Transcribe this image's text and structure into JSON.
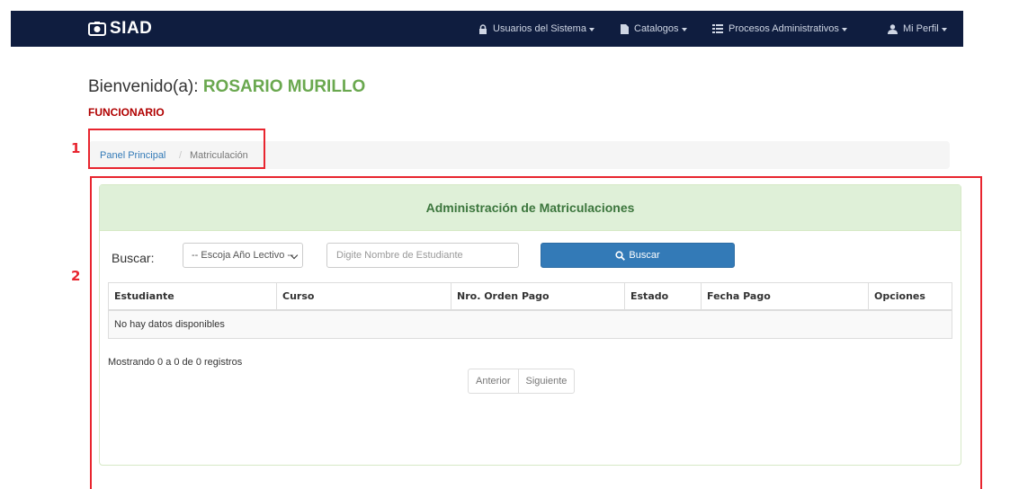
{
  "navbar": {
    "brand": "SIAD",
    "items": [
      {
        "label": "Usuarios del Sistema",
        "icon": "lock-icon"
      },
      {
        "label": "Catalogos",
        "icon": "file-icon"
      },
      {
        "label": "Procesos Administrativos",
        "icon": "list-icon"
      },
      {
        "label": "Mi Perfil",
        "icon": "user-icon"
      }
    ]
  },
  "welcome": {
    "prefix": "Bienvenido(a):",
    "name": "ROSARIO MURILLO",
    "role": "FUNCIONARIO"
  },
  "breadcrumb": {
    "home": "Panel Principal",
    "separator": "/",
    "current": "Matriculación"
  },
  "annotations": {
    "label_1": "1",
    "label_2": "2",
    "color": "#e8252f"
  },
  "panel": {
    "title": "Administración de Matriculaciones",
    "search_label": "Buscar:",
    "year_select": "-- Escoja Año Lectivo --",
    "student_placeholder": "Digite Nombre de Estudiante",
    "search_button": "Buscar",
    "table": {
      "columns": [
        "Estudiante",
        "Curso",
        "Nro. Orden Pago",
        "Estado",
        "Fecha Pago",
        "Opciones"
      ],
      "empty_message": "No hay datos disponibles"
    },
    "info": "Mostrando 0 a 0 de 0 registros",
    "pagination": {
      "prev": "Anterior",
      "next": "Siguiente"
    }
  },
  "colors": {
    "navbar": "#0f1d3f",
    "name": "#6aa84f",
    "role": "#b00000",
    "panel_heading": "#dff0d8",
    "primary_button": "#337ab7"
  }
}
